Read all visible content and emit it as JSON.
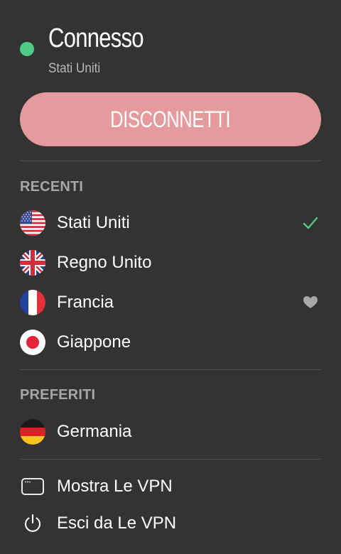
{
  "status": {
    "title": "Connesso",
    "subtitle": "Stati Uniti",
    "indicator_color": "#4fcb86"
  },
  "disconnect_button": {
    "label": "DISCONNETTI",
    "color": "#e59b9d"
  },
  "recent": {
    "title": "RECENTI",
    "items": [
      {
        "label": "Stati Uniti",
        "flag": "us-flag-icon",
        "trailing": "checkmark-icon"
      },
      {
        "label": "Regno Unito",
        "flag": "uk-flag-icon",
        "trailing": ""
      },
      {
        "label": "Francia",
        "flag": "france-flag-icon",
        "trailing": "heart-icon"
      },
      {
        "label": "Giappone",
        "flag": "japan-flag-icon",
        "trailing": ""
      }
    ]
  },
  "favorites": {
    "title": "PREFERITI",
    "items": [
      {
        "label": "Germania",
        "flag": "germany-flag-icon"
      }
    ]
  },
  "actions": {
    "show_vpn": {
      "label": "Mostra Le VPN",
      "icon": "window-icon"
    },
    "quit_vpn": {
      "label": "Esci da Le VPN",
      "icon": "power-icon"
    }
  }
}
